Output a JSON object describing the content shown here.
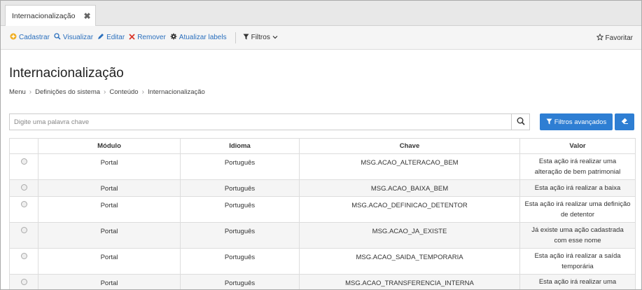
{
  "tabs": [
    {
      "label": "Internacionalização",
      "close": "✖"
    }
  ],
  "toolbar": {
    "cadastrar": "Cadastrar",
    "visualizar": "Visualizar",
    "editar": "Editar",
    "remover": "Remover",
    "atualizar": "Atualizar labels",
    "filtros": "Filtros",
    "favoritar": "Favoritar"
  },
  "page": {
    "title": "Internacionalização",
    "breadcrumb": [
      "Menu",
      "Definições do sistema",
      "Conteúdo",
      "Internacionalização"
    ]
  },
  "search": {
    "placeholder": "Digite uma palavra chave",
    "value": "",
    "advanced_label": "Filtros avançados"
  },
  "table": {
    "headers": [
      "",
      "Módulo",
      "Idioma",
      "Chave",
      "Valor"
    ],
    "rows": [
      {
        "modulo": "Portal",
        "idioma": "Português",
        "chave": "MSG.ACAO_ALTERACAO_BEM",
        "valor": "Esta ação irá realizar uma alteração de bem patrimonial"
      },
      {
        "modulo": "Portal",
        "idioma": "Português",
        "chave": "MSG.ACAO_BAIXA_BEM",
        "valor": "Esta ação irá realizar a baixa"
      },
      {
        "modulo": "Portal",
        "idioma": "Português",
        "chave": "MSG.ACAO_DEFINICAO_DETENTOR",
        "valor": "Esta ação irá realizar uma definição de detentor"
      },
      {
        "modulo": "Portal",
        "idioma": "Português",
        "chave": "MSG.ACAO_JA_EXISTE",
        "valor": "Já existe uma ação cadastrada com esse nome"
      },
      {
        "modulo": "Portal",
        "idioma": "Português",
        "chave": "MSG.ACAO_SAIDA_TEMPORARIA",
        "valor": "Esta ação irá realizar a saída temporária"
      },
      {
        "modulo": "Portal",
        "idioma": "Português",
        "chave": "MSG.ACAO_TRANSFERENCIA_INTERNA",
        "valor": "Esta ação irá realizar uma transferência interna"
      }
    ]
  },
  "colors": {
    "accent": "#2e7ed3",
    "link": "#2a6fbd",
    "remove": "#d9372b",
    "add": "#f0ad1e"
  },
  "icons": [
    "close-icon",
    "plus-circle-icon",
    "search-icon",
    "pencil-icon",
    "x-icon",
    "gear-icon",
    "filter-icon",
    "chevron-down-icon",
    "star-icon",
    "eraser-icon"
  ]
}
